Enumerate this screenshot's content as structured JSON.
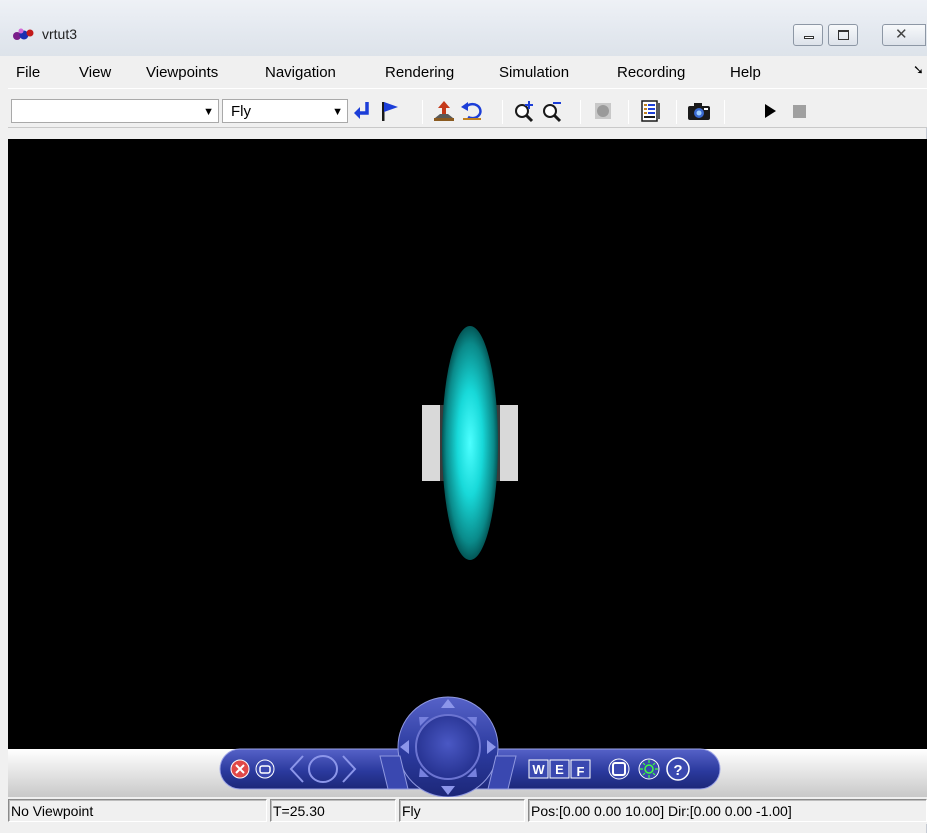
{
  "window": {
    "title": "vrtut3",
    "icon": "vr-app-logo-icon",
    "controls": [
      "minimize-icon",
      "maximize-icon",
      "close-icon"
    ]
  },
  "menubar": {
    "items": [
      "File",
      "View",
      "Viewpoints",
      "Navigation",
      "Rendering",
      "Simulation",
      "Recording",
      "Help"
    ],
    "overflow_icon": "chevron-overflow-icon"
  },
  "toolbar": {
    "viewpoint_select": {
      "value": ""
    },
    "navigation_mode_select": {
      "value": "Fly"
    },
    "icons": [
      "return-to-viewpoint-icon",
      "create-viewpoint-icon",
      "straighten-up-icon",
      "undo-move-icon",
      "zoom-in-icon",
      "zoom-out-icon",
      "headlight-icon",
      "edit-world-icon",
      "capture-frame-icon",
      "start-simulation-icon",
      "stop-simulation-icon"
    ]
  },
  "viewport": {
    "background": "#000000",
    "object_color": "#00e5e5",
    "bracket_color": "#d9d9d9"
  },
  "navpanel": {
    "color": "#2b3a9e",
    "mode_buttons": [
      "W",
      "E",
      "F"
    ],
    "help_label": "?"
  },
  "statusbar": {
    "viewpoint": "No Viewpoint",
    "time": "T=25.30",
    "mode": "Fly",
    "position": "Pos:[0.00 0.00 10.00] Dir:[0.00 0.00 -1.00]"
  }
}
